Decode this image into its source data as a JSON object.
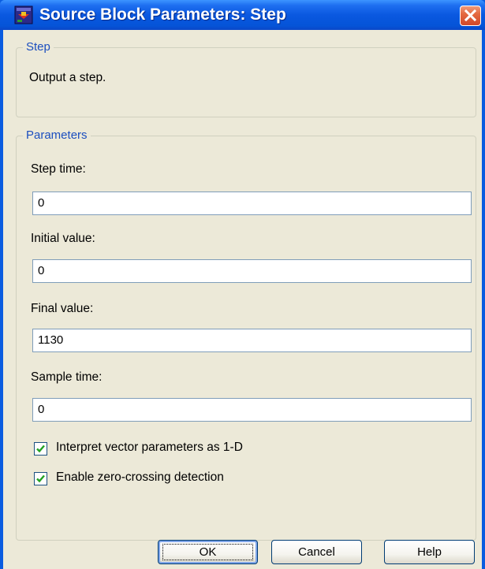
{
  "window": {
    "title": "Source Block Parameters: Step",
    "accent": "#0a5ce0",
    "close_icon": "close-x"
  },
  "description_group": {
    "legend": "Step",
    "text": "Output a step."
  },
  "parameters_group": {
    "legend": "Parameters",
    "fields": [
      {
        "label": "Step time:",
        "value": "0"
      },
      {
        "label": "Initial value:",
        "value": "0"
      },
      {
        "label": "Final value:",
        "value": "1130"
      },
      {
        "label": "Sample time:",
        "value": "0"
      }
    ],
    "checkboxes": [
      {
        "label": "Interpret vector parameters as 1-D",
        "checked": true
      },
      {
        "label": "Enable zero-crossing detection",
        "checked": true
      }
    ]
  },
  "buttons": {
    "ok": "OK",
    "cancel": "Cancel",
    "help": "Help"
  }
}
